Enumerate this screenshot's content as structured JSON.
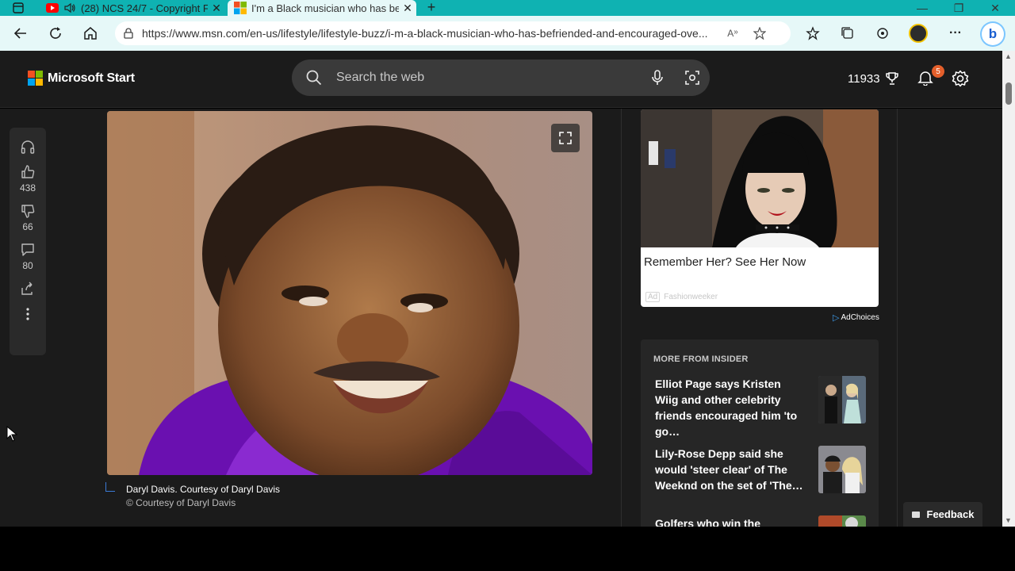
{
  "browser": {
    "tabs": [
      {
        "title": "(28) NCS 24/7 - Copyright F",
        "favicon": "youtube-icon",
        "audio": true,
        "active": false
      },
      {
        "title": "I'm a Black musician who has bef",
        "favicon": "msn-icon",
        "active": true
      }
    ],
    "url": "https://www.msn.com/en-us/lifestyle/lifestyle-buzz/i-m-a-black-musician-who-has-befriended-and-encouraged-ove...",
    "tab_bar_color": "#0fb2b2",
    "toolbar_color": "#e6f8f8"
  },
  "header": {
    "brand": "Microsoft Start",
    "search_placeholder": "Search the web",
    "points": "11933",
    "notifications": "5"
  },
  "rail": {
    "likes": "438",
    "dislikes": "66",
    "comments": "80"
  },
  "article": {
    "caption": "Daryl Davis. Courtesy of Daryl Davis",
    "credit": "© Courtesy of Daryl Davis"
  },
  "ad": {
    "title": "Remember Her? See Her Now",
    "tag": "Ad",
    "source": "Fashionweeker",
    "adchoices": "AdChoices"
  },
  "more": {
    "heading": "MORE FROM INSIDER",
    "items": [
      {
        "title": "Elliot Page says Kristen Wiig and other celebrity friends encouraged him 'to go…"
      },
      {
        "title": "Lily-Rose Depp said she would 'steer clear' of The Weeknd on the set of 'The…"
      },
      {
        "title": "Golfers who win the Masters"
      }
    ]
  },
  "feedback": "Feedback",
  "colors": {
    "page_bg": "#1b1b1b",
    "badge": "#e45f2b",
    "logo": [
      "#f25022",
      "#7fba00",
      "#00a4ef",
      "#ffb900"
    ]
  }
}
